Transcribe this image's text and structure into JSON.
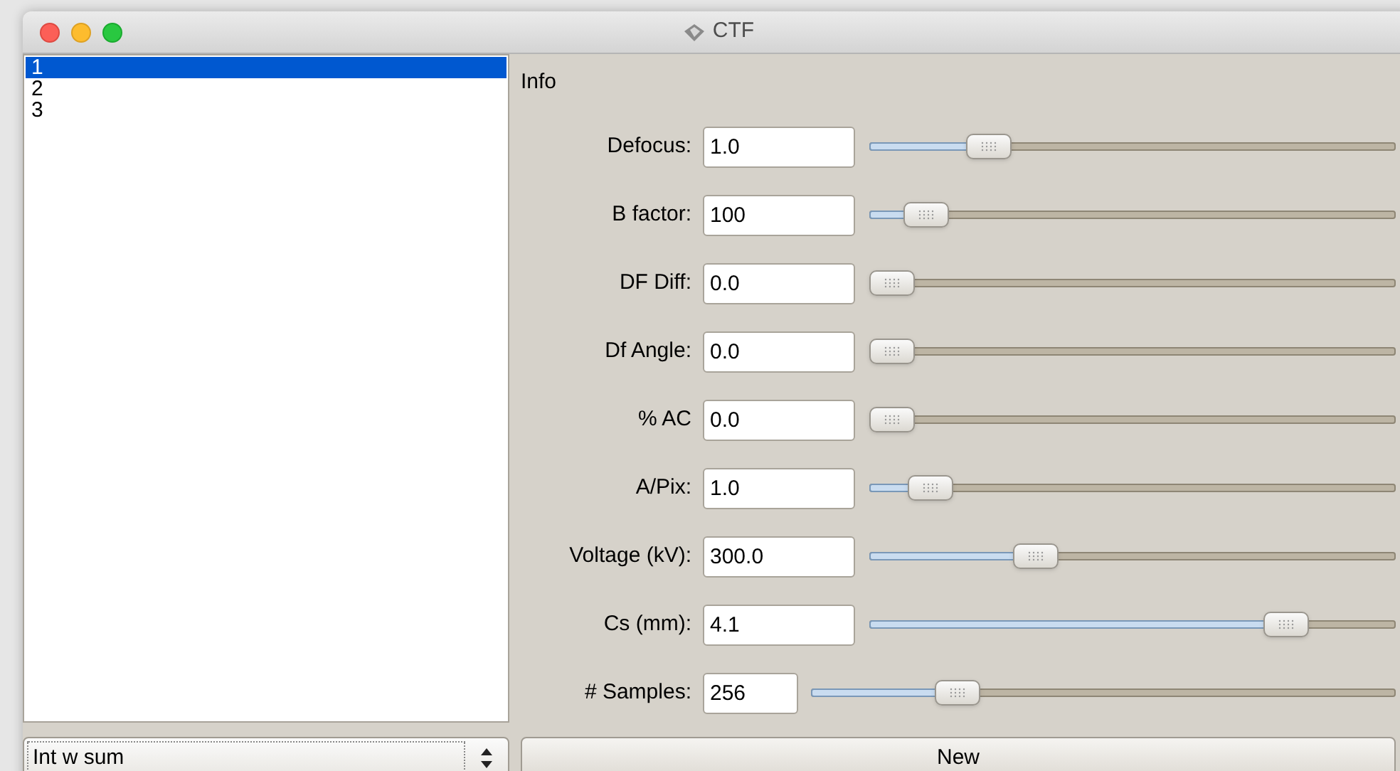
{
  "window": {
    "title": "CTF"
  },
  "list": {
    "items": [
      {
        "label": "1",
        "selected": true
      },
      {
        "label": "2",
        "selected": false
      },
      {
        "label": "3",
        "selected": false
      }
    ]
  },
  "combo": {
    "value": "Int w sum"
  },
  "info": {
    "title": "Info"
  },
  "params": [
    {
      "label": "Defocus:",
      "value": "1.0",
      "level": 0.2,
      "kind": "wide"
    },
    {
      "label": "B factor:",
      "value": "100",
      "level": 0.07,
      "kind": "wide"
    },
    {
      "label": "DF Diff:",
      "value": "0.0",
      "level": 0,
      "kind": "wide"
    },
    {
      "label": "Df Angle:",
      "value": "0.0",
      "level": 0,
      "kind": "wide"
    },
    {
      "label": "% AC",
      "value": "0.0",
      "level": 0,
      "kind": "wide"
    },
    {
      "label": "A/Pix:",
      "value": "1.0",
      "level": 0.08,
      "kind": "wide"
    },
    {
      "label": "Voltage (kV):",
      "value": "300.0",
      "level": 0.3,
      "kind": "wide"
    },
    {
      "label": "Cs (mm):",
      "value": "4.1",
      "level": 0.82,
      "kind": "wide"
    },
    {
      "label": "# Samples:",
      "value": "256",
      "level": 0.23,
      "kind": "narrow"
    }
  ],
  "new_button": {
    "label": "New"
  }
}
